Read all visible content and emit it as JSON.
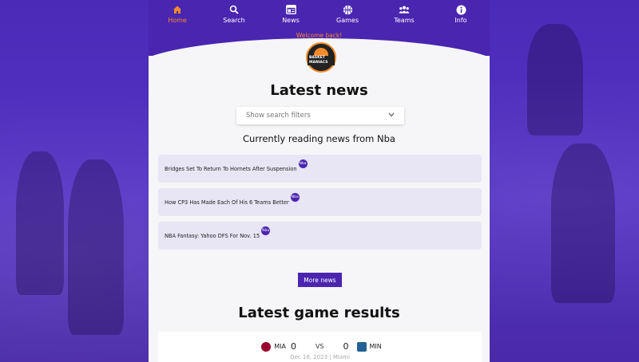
{
  "nav": [
    {
      "label": "Home",
      "icon": "home-icon"
    },
    {
      "label": "Search",
      "icon": "search-icon"
    },
    {
      "label": "News",
      "icon": "news-icon"
    },
    {
      "label": "Games",
      "icon": "basketball-icon"
    },
    {
      "label": "Teams",
      "icon": "teams-icon"
    },
    {
      "label": "Info",
      "icon": "info-icon"
    }
  ],
  "welcome": "Welcome back!",
  "logo_text": "BASKET MANIACS",
  "latest_news_title": "Latest news",
  "filter_placeholder": "Show search filters",
  "reading_text": "Currently reading news from Nba",
  "news": [
    {
      "title": "Bridges Set To Return To Hornets After Suspension",
      "badge": "Nba"
    },
    {
      "title": "How CP3 Has Made Each Of His 6 Teams Better",
      "badge": "Nba"
    },
    {
      "title": "NBA Fantasy: Yahoo DFS For Nov. 15",
      "badge": "Nba"
    }
  ],
  "more_news_label": "More news",
  "latest_games_title": "Latest game results",
  "game": {
    "home": "MIA",
    "home_score": "0",
    "vs": "VS",
    "away_score": "0",
    "away": "MIN",
    "date": "Dec 16, 2023 | Miami"
  },
  "colors": {
    "primary": "#4a25b0",
    "accent": "#f58a2b"
  }
}
